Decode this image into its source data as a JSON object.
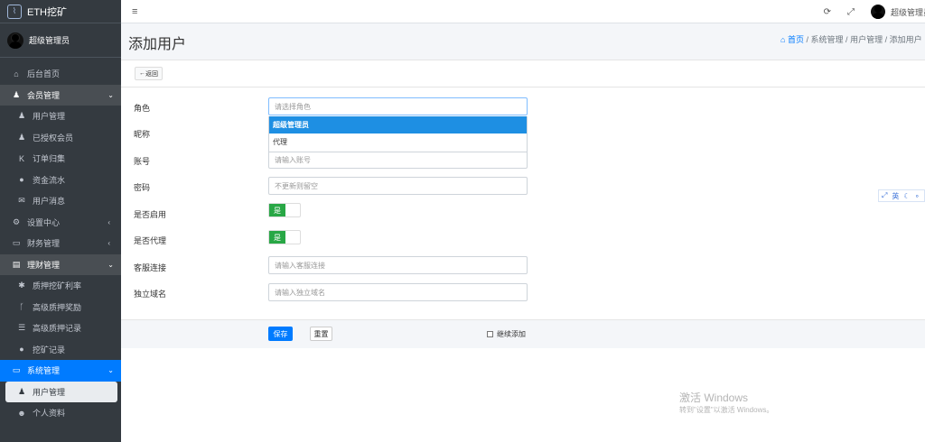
{
  "app": {
    "title": "ETH挖矿",
    "user_name": "超级管理员"
  },
  "sidebar": {
    "items": [
      {
        "icon": "home-icon",
        "glyph": "⌂",
        "label": "后台首页"
      },
      {
        "icon": "users-icon",
        "glyph": "♟",
        "label": "会员管理"
      },
      {
        "icon": "user-icon",
        "glyph": "♟",
        "label": "用户管理"
      },
      {
        "icon": "users-icon",
        "glyph": "♟",
        "label": "已授权会员"
      },
      {
        "icon": "k-icon",
        "glyph": "K",
        "label": "订单归集"
      },
      {
        "icon": "droplet-icon",
        "glyph": "●",
        "label": "资金流水"
      },
      {
        "icon": "envelope-icon",
        "glyph": "✉",
        "label": "用户消息"
      },
      {
        "icon": "gears-icon",
        "glyph": "⚙",
        "label": "设置中心"
      },
      {
        "icon": "card-icon",
        "glyph": "▭",
        "label": "财务管理"
      },
      {
        "icon": "file-icon",
        "glyph": "▤",
        "label": "理财管理"
      },
      {
        "icon": "gauge-icon",
        "glyph": "✱",
        "label": "质押挖矿利率"
      },
      {
        "icon": "branch-icon",
        "glyph": "ᚴ",
        "label": "高级质押奖励"
      },
      {
        "icon": "list-icon",
        "glyph": "☰",
        "label": "高级质押记录"
      },
      {
        "icon": "droplet-icon",
        "glyph": "●",
        "label": "挖矿记录"
      },
      {
        "icon": "desktop-icon",
        "glyph": "▭",
        "label": "系统管理"
      },
      {
        "icon": "user-icon",
        "glyph": "♟",
        "label": "用户管理"
      },
      {
        "icon": "smile-icon",
        "glyph": "☻",
        "label": "个人资料"
      }
    ]
  },
  "topbar": {
    "menu_glyph": "≡",
    "refresh_glyph": "⟳",
    "fullscreen_glyph": "⤢",
    "user_name": "超级管理员"
  },
  "page": {
    "title": "添加用户",
    "breadcrumb": {
      "home": "首页",
      "sep": "/",
      "items": [
        "系统管理",
        "用户管理",
        "添加用户"
      ]
    }
  },
  "form": {
    "back_label": "返回",
    "fields": {
      "role": {
        "label": "角色",
        "placeholder": "请选择角色"
      },
      "nickname": {
        "label": "昵称"
      },
      "account": {
        "label": "账号",
        "placeholder": "请输入账号"
      },
      "password": {
        "label": "密码",
        "placeholder": "不更新则留空"
      },
      "enabled": {
        "label": "是否启用",
        "value": "是"
      },
      "agent": {
        "label": "是否代理",
        "value": "是"
      },
      "service_link": {
        "label": "客服连接",
        "placeholder": "请输入客服连接"
      },
      "domain": {
        "label": "独立域名",
        "placeholder": "请输入独立域名"
      }
    },
    "role_options": [
      "超级管理员",
      "代理"
    ],
    "save_label": "保存",
    "reset_label": "重置",
    "continue_label": "继续添加"
  },
  "float_tools": {
    "lang": "英"
  },
  "watermark": {
    "line1": "激活 Windows",
    "line2": "转到\"设置\"以激活 Windows。"
  },
  "colors": {
    "sidebar": "#343a40",
    "accent": "#007bff",
    "success": "#28a745"
  }
}
